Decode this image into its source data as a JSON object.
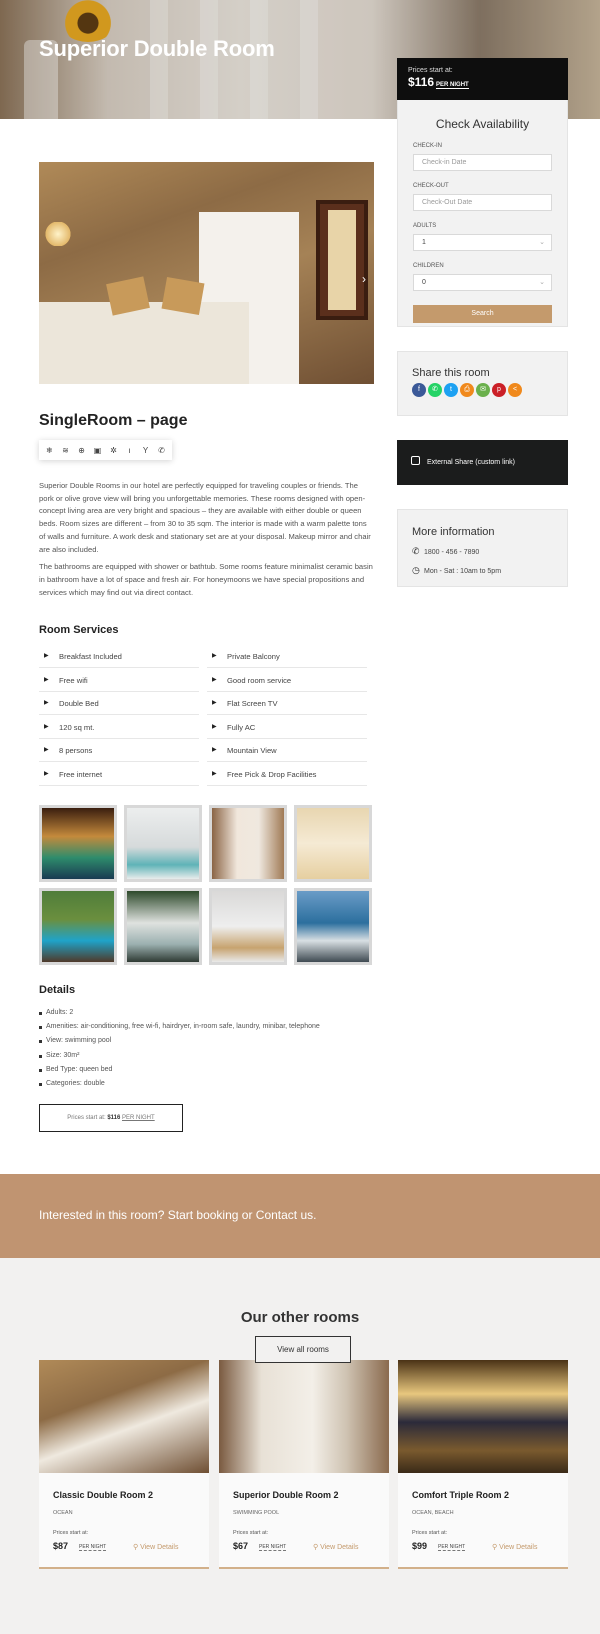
{
  "hero": {
    "title": "Superior Double Room"
  },
  "price_box": {
    "label": "Prices start at:",
    "amount": "$116",
    "per": "PER NIGHT"
  },
  "availability": {
    "title": "Check Availability",
    "checkin_label": "CHECK-IN",
    "checkin_placeholder": "Check-in Date",
    "checkout_label": "CHECK-OUT",
    "checkout_placeholder": "Check-Out Date",
    "adults_label": "ADULTS",
    "adults_value": "1",
    "children_label": "CHILDREN",
    "children_value": "0",
    "search_label": "Search"
  },
  "share": {
    "title": "Share this room",
    "icons": [
      {
        "name": "facebook-icon",
        "glyph": "f",
        "color": "#3b5998"
      },
      {
        "name": "whatsapp-icon",
        "glyph": "✆",
        "color": "#25d366"
      },
      {
        "name": "twitter-icon",
        "glyph": "t",
        "color": "#1da1f2"
      },
      {
        "name": "print-icon",
        "glyph": "⎙",
        "color": "#f0891c"
      },
      {
        "name": "email-icon",
        "glyph": "✉",
        "color": "#6ab04c"
      },
      {
        "name": "pinterest-icon",
        "glyph": "p",
        "color": "#cb2027"
      },
      {
        "name": "share-icon",
        "glyph": "<",
        "color": "#f0891c"
      }
    ]
  },
  "external_share": {
    "label": "External Share (custom link)"
  },
  "more_info": {
    "title": "More information",
    "phone": "1800 - 456 - 7890",
    "hours": "Mon - Sat : 10am to 5pm"
  },
  "room": {
    "title": "SingleRoom – page",
    "amenity_icons": [
      "snowflake-icon",
      "wifi-icon",
      "target-icon",
      "lock-icon",
      "gear-icon",
      "bottle-icon",
      "cocktail-icon",
      "phone-icon"
    ],
    "description": [
      "Superior Double Rooms in our hotel are perfectly equipped for traveling couples or friends. The pork or olive grove view will bring you unforgettable memories. These rooms designed with open-concept living area are very bright and spacious – they are available with either double or queen beds. Room sizes are different – from 30 to 35 sqm. The interior is made with a warm palette tons of walls and furniture. A work desk and stationary set are at your disposal. Makeup mirror and chair are also included.",
      "The bathrooms are equipped with shower or bathtub. Some rooms feature minimalist ceramic basin in bathroom have a lot of space and fresh air. For honeymoons we have special propositions and services which may find out via direct contact."
    ]
  },
  "services": {
    "title": "Room Services",
    "left": [
      "Breakfast Included",
      "Free wifi",
      "Double Bed",
      "120 sq mt.",
      "8 persons",
      "Free internet"
    ],
    "right": [
      "Private Balcony",
      "Good room service",
      "Flat Screen TV",
      "Fully AC",
      "Mountain View",
      "Free Pick & Drop Facilities"
    ]
  },
  "details": {
    "title": "Details",
    "items": [
      "Adults: 2",
      "Amenities: air-conditioning, free wi-fi, hairdryer, in-room safe, laundry, minibar, telephone",
      "View: swimming pool",
      "Size: 30m²",
      "Bed Type: queen bed",
      "Categories: double"
    ],
    "price_prefix": "Prices start at:",
    "price_amount": "$116",
    "price_per": "PER NIGHT"
  },
  "cta": {
    "text": "Interested in this room? Start booking or Contact us."
  },
  "other_rooms": {
    "title": "Our other rooms",
    "cards": [
      {
        "name": "Classic Double Room 2",
        "tag": "OCEAN",
        "price_label": "Prices start at:",
        "amount": "$87",
        "per": "PER NIGHT",
        "view": "View Details"
      },
      {
        "name": "Superior Double Room 2",
        "tag": "SWIMMING POOL",
        "price_label": "Prices start at:",
        "amount": "$67",
        "per": "PER NIGHT",
        "view": "View Details"
      },
      {
        "name": "Comfort Triple Room 2",
        "tag": "OCEAN, BEACH",
        "price_label": "Prices start at:",
        "amount": "$99",
        "per": "PER NIGHT",
        "view": "View Details"
      }
    ],
    "view_all": "View all rooms"
  }
}
